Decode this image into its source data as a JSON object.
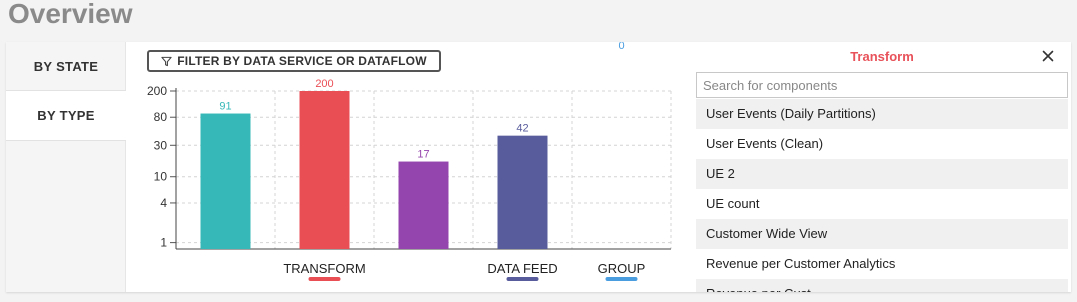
{
  "page": {
    "title": "Overview"
  },
  "tabs": [
    {
      "label": "BY STATE"
    },
    {
      "label": "BY TYPE"
    }
  ],
  "filter": {
    "label": "FILTER BY DATA SERVICE OR DATAFLOW"
  },
  "panel": {
    "title": "Transform",
    "search_placeholder": "Search for components",
    "items": [
      "User Events (Daily Partitions)",
      "User Events (Clean)",
      "UE 2",
      "UE count",
      "Customer Wide View",
      "Revenue per Customer Analytics",
      "Revenue per Cust..."
    ]
  },
  "colors": {
    "accent": "#e8525a",
    "transform": "#ea4e55",
    "teal": "#36b8b8",
    "purple": "#9546ae",
    "datafeed": "#585c9c",
    "group": "#4a9ee0"
  },
  "chart_data": {
    "type": "bar",
    "yscale": "log",
    "ylim": [
      0.8,
      200
    ],
    "yticks": [
      1,
      4,
      10,
      30,
      80,
      200
    ],
    "grid": true,
    "categories": [
      "",
      "TRANSFORM",
      "",
      "DATA FEED",
      "GROUP"
    ],
    "values": [
      91,
      200,
      17,
      42,
      0
    ],
    "data_labels": [
      "91",
      "200",
      "17",
      "42",
      "0"
    ],
    "bar_colors": [
      "#36b8b8",
      "#ea4e55",
      "#9546ae",
      "#585c9c",
      "#4a9ee0"
    ],
    "label_colors": [
      "#36b8b8",
      "#ea4e55",
      "#9546ae",
      "#585c9c",
      "#4a9ee0"
    ],
    "legend_colors": [
      "",
      "#ea4e55",
      "",
      "#585c9c",
      "#4a9ee0"
    ]
  }
}
